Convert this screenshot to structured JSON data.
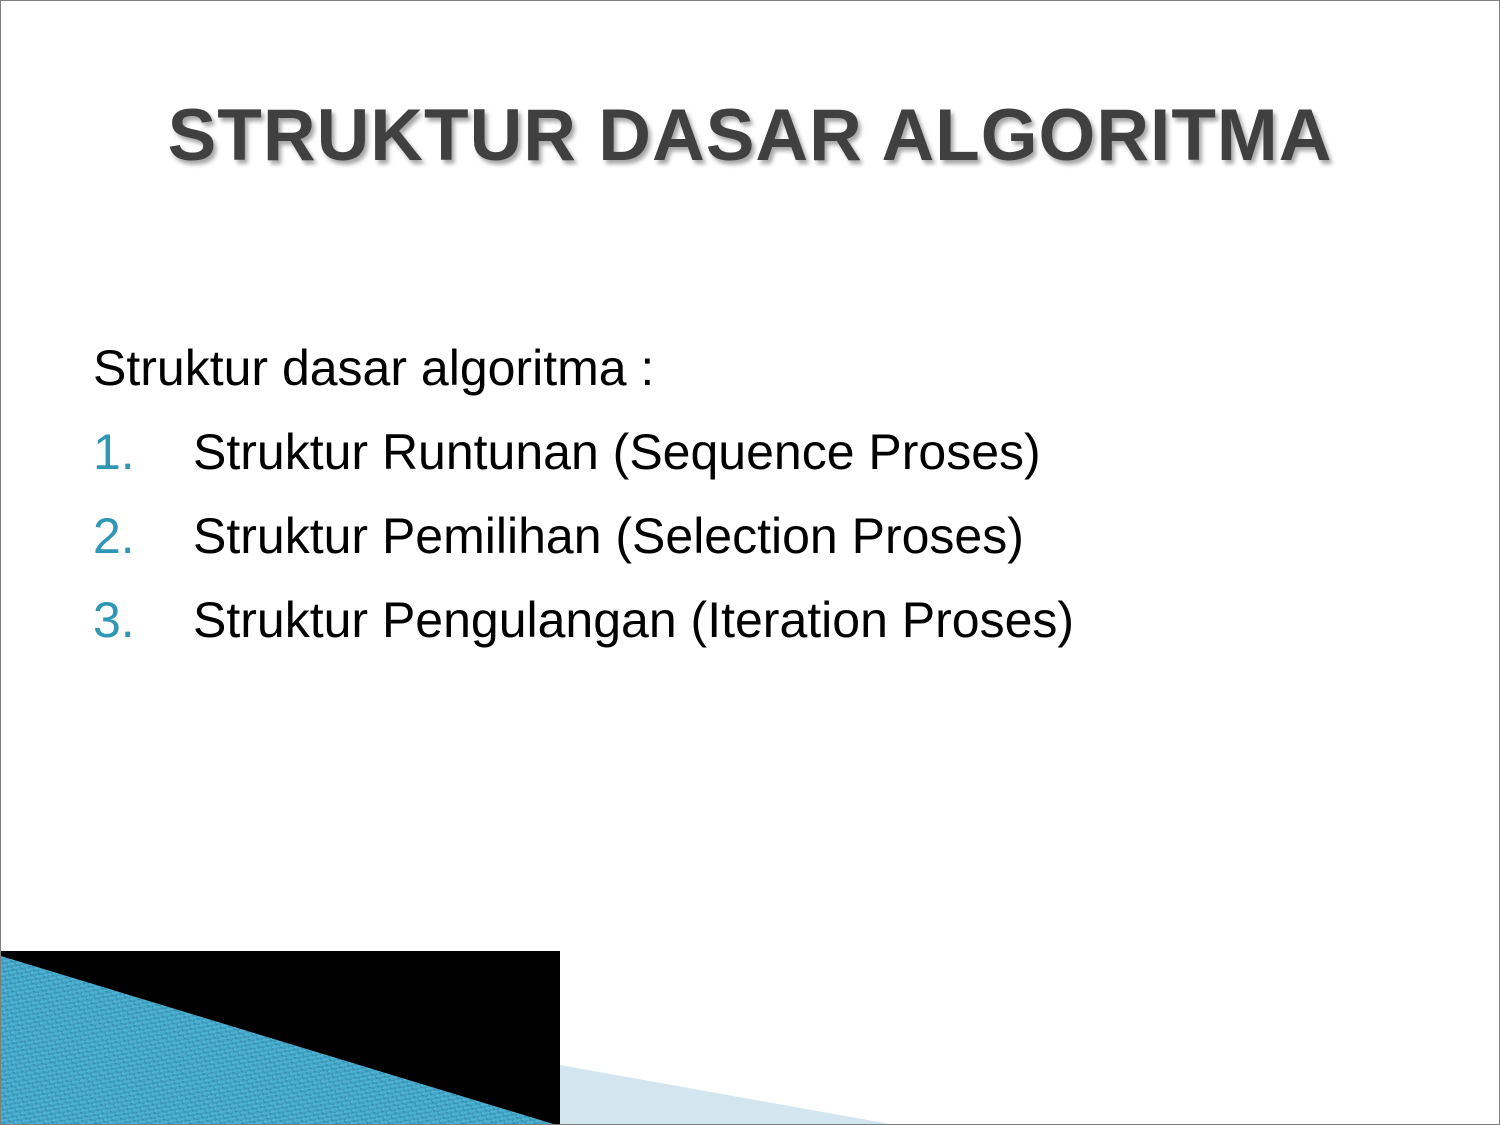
{
  "slide": {
    "title": "STRUKTUR DASAR ALGORITMA",
    "intro": "Struktur dasar algoritma :",
    "items": [
      {
        "number": "1.",
        "text": "Struktur Runtunan (Sequence Proses)"
      },
      {
        "number": "2.",
        "text": "Struktur Pemilihan (Selection Proses)"
      },
      {
        "number": "3.",
        "text": "Struktur Pengulangan (Iteration Proses)"
      }
    ]
  },
  "colors": {
    "title": "#404040",
    "number_accent": "#2e97b4",
    "body_text": "#000000",
    "decor_dark": "#000000",
    "decor_blue": "#3aa5c8",
    "decor_light_blue": "#d3e6f0"
  }
}
